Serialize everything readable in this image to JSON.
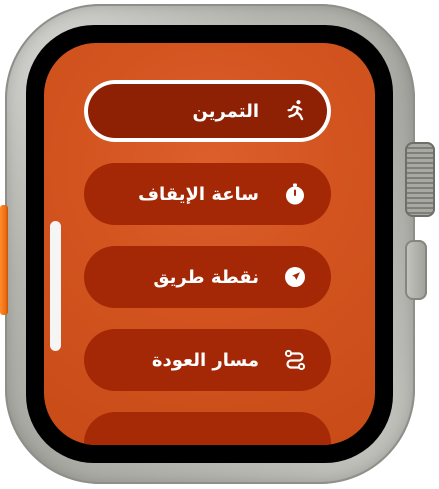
{
  "colors": {
    "screen_background": "#d3541f",
    "item_background": "#a42806",
    "selected_outline": "#ffffff",
    "text": "#ffffff",
    "side_button": "#ee6e12"
  },
  "menu": {
    "items": [
      {
        "label": "التمرين",
        "icon": "workout-runner-icon",
        "selected": true
      },
      {
        "label": "ساعة الإيقاف",
        "icon": "stopwatch-icon",
        "selected": false
      },
      {
        "label": "نقطة طريق",
        "icon": "waypoint-location-icon",
        "selected": false
      },
      {
        "label": "مسار العودة",
        "icon": "backtrack-route-icon",
        "selected": false
      }
    ]
  }
}
